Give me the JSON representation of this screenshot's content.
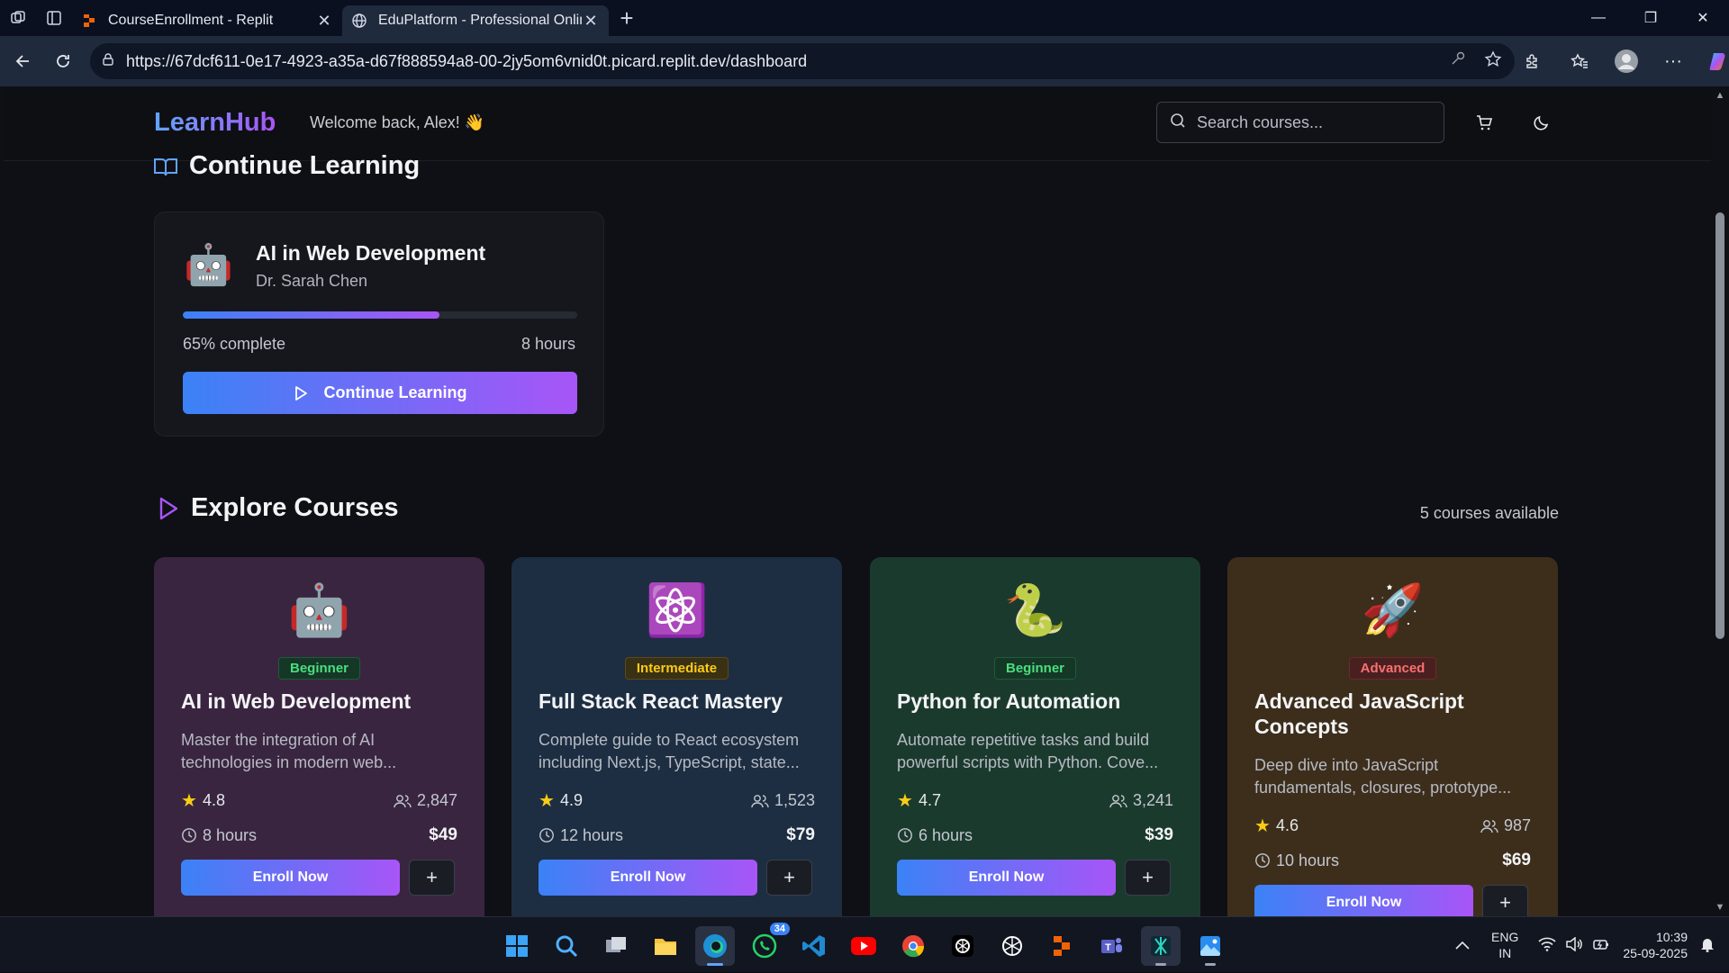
{
  "browser": {
    "tabs": [
      {
        "title": "CourseEnrollment - Replit",
        "active": false
      },
      {
        "title": "EduPlatform - Professional Online",
        "active": true
      }
    ],
    "url": "https://67dcf611-0e17-4923-a35a-d67f888594a8-00-2jy5om6vnid0t.picard.replit.dev/dashboard"
  },
  "header": {
    "logo": "LearnHub",
    "welcome": "Welcome back, Alex! 👋",
    "search_placeholder": "Search courses..."
  },
  "continue": {
    "heading": "Continue Learning",
    "course": {
      "emoji": "🤖",
      "title": "AI in Web Development",
      "instructor": "Dr. Sarah Chen",
      "progress_percent": 65,
      "progress_label": "65% complete",
      "hours": "8 hours",
      "button": "Continue Learning"
    }
  },
  "explore": {
    "heading": "Explore Courses",
    "count_label": "5 courses available",
    "courses": [
      {
        "emoji": "🤖",
        "level": "Beginner",
        "title": "AI in Web Development",
        "desc": "Master the integration of AI technologies in modern web...",
        "rating": "4.8",
        "students": "2,847",
        "duration": "8 hours",
        "price": "$49",
        "enroll": "Enroll Now",
        "bg": "#3a2540"
      },
      {
        "emoji": "⚛️",
        "level": "Intermediate",
        "title": "Full Stack React Mastery",
        "desc": "Complete guide to React ecosystem including Next.js, TypeScript, state...",
        "rating": "4.9",
        "students": "1,523",
        "duration": "12 hours",
        "price": "$79",
        "enroll": "Enroll Now",
        "bg": "#1d2e42"
      },
      {
        "emoji": "🐍",
        "level": "Beginner",
        "title": "Python for Automation",
        "desc": "Automate repetitive tasks and build powerful scripts with Python. Cove...",
        "rating": "4.7",
        "students": "3,241",
        "duration": "6 hours",
        "price": "$39",
        "enroll": "Enroll Now",
        "bg": "#1b3a2e"
      },
      {
        "emoji": "🚀",
        "level": "Advanced",
        "title": "Advanced JavaScript Concepts",
        "desc": "Deep dive into JavaScript fundamentals, closures, prototype...",
        "rating": "4.6",
        "students": "987",
        "duration": "10 hours",
        "price": "$69",
        "enroll": "Enroll Now",
        "bg": "#3d2e1c"
      }
    ]
  },
  "taskbar": {
    "whatsapp_badge": "34",
    "lang_line1": "ENG",
    "lang_line2": "IN",
    "time": "10:39",
    "date": "25-09-2025"
  }
}
